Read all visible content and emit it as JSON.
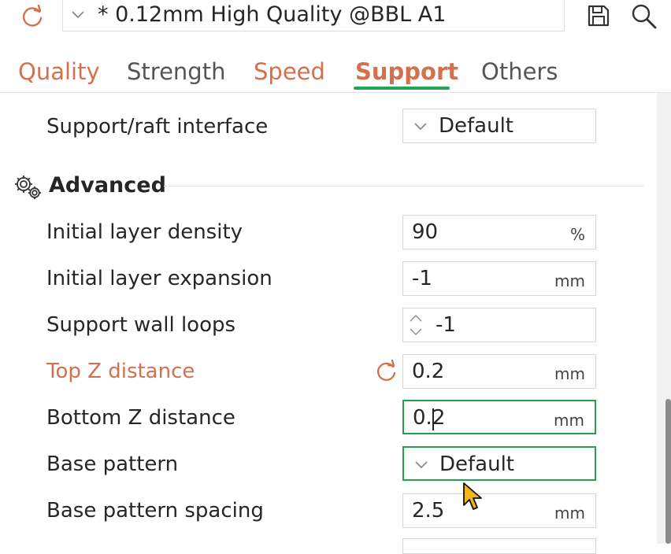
{
  "preset": {
    "name": "* 0.12mm High Quality @BBL A1",
    "icons": {
      "reset": "reset-arrow-icon",
      "dropdown": "chevron-down-icon",
      "save": "save-icon",
      "search": "search-icon"
    }
  },
  "tabs": [
    {
      "label": "Quality",
      "state": "modified"
    },
    {
      "label": "Strength",
      "state": "normal"
    },
    {
      "label": "Speed",
      "state": "modified"
    },
    {
      "label": "Support",
      "state": "active"
    },
    {
      "label": "Others",
      "state": "normal"
    }
  ],
  "rows": {
    "support_raft_interface": {
      "label": "Support/raft interface",
      "value": "Default"
    },
    "initial_layer_density": {
      "label": "Initial layer density",
      "value": "90",
      "unit": "%"
    },
    "initial_layer_expansion": {
      "label": "Initial layer expansion",
      "value": "-1",
      "unit": "mm"
    },
    "support_wall_loops": {
      "label": "Support wall loops",
      "value": "-1"
    },
    "top_z_distance": {
      "label": "Top Z distance",
      "value": "0.2",
      "unit": "mm"
    },
    "bottom_z_distance": {
      "label": "Bottom Z distance",
      "value": "0.2",
      "value_before_caret": "0.",
      "value_after_caret": "2",
      "unit": "mm"
    },
    "base_pattern": {
      "label": "Base pattern",
      "value": "Default"
    },
    "base_pattern_spacing": {
      "label": "Base pattern spacing",
      "value": "2.5",
      "unit": "mm"
    }
  },
  "section": {
    "title": "Advanced",
    "icon": "gears-icon"
  },
  "colors": {
    "accent_green": "#21a651",
    "modified_orange": "#d5704f",
    "text": "#262626"
  }
}
